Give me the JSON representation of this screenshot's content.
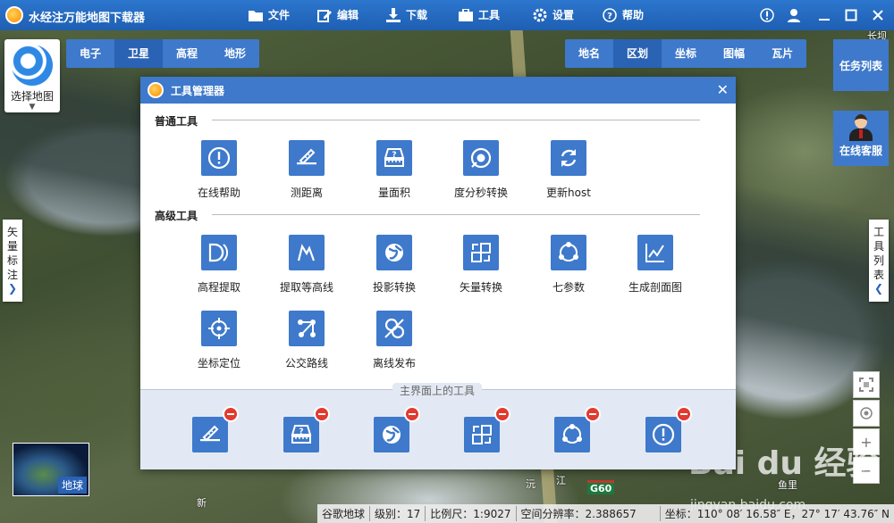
{
  "app": {
    "title": "水经注万能地图下载器"
  },
  "menu": [
    {
      "label": "文件",
      "icon": "folder-icon"
    },
    {
      "label": "编辑",
      "icon": "edit-icon"
    },
    {
      "label": "下载",
      "icon": "download-icon"
    },
    {
      "label": "工具",
      "icon": "toolbox-icon"
    },
    {
      "label": "设置",
      "icon": "gear-icon"
    },
    {
      "label": "帮助",
      "icon": "help-icon"
    }
  ],
  "window_controls": [
    "info-icon",
    "user-icon",
    "minimize-icon",
    "maximize-icon",
    "close-icon"
  ],
  "map_type_tabs": [
    {
      "label": "电子",
      "active": false
    },
    {
      "label": "卫星",
      "active": true
    },
    {
      "label": "高程",
      "active": false
    },
    {
      "label": "地形",
      "active": false
    }
  ],
  "region_tabs": [
    {
      "label": "地名",
      "active": false
    },
    {
      "label": "区划",
      "active": true
    },
    {
      "label": "坐标",
      "active": false
    },
    {
      "label": "图幅",
      "active": false
    },
    {
      "label": "瓦片",
      "active": false
    }
  ],
  "select_map": {
    "label": "选择地图"
  },
  "task_list": {
    "label": "任务列表"
  },
  "online_service": {
    "label": "在线客服"
  },
  "left_side_tab": {
    "label": "矢量标注",
    "chars": [
      "矢",
      "量",
      "标",
      "注"
    ]
  },
  "right_side_tab": {
    "label": "工具列表",
    "chars": [
      "工",
      "具",
      "列",
      "表"
    ]
  },
  "earth_mini": {
    "label": "地球"
  },
  "tool_manager": {
    "title": "工具管理器",
    "sections": {
      "common": {
        "title": "普通工具",
        "tools": [
          {
            "label": "在线帮助",
            "icon": "help-circle-icon"
          },
          {
            "label": "测距离",
            "icon": "ruler-icon"
          },
          {
            "label": "量面积",
            "icon": "area-measure-icon"
          },
          {
            "label": "度分秒转换",
            "icon": "dms-convert-icon"
          },
          {
            "label": "更新host",
            "icon": "refresh-icon"
          }
        ]
      },
      "advanced": {
        "title": "高级工具",
        "tools": [
          {
            "label": "高程提取",
            "icon": "elevation-icon"
          },
          {
            "label": "提取等高线",
            "icon": "contour-icon"
          },
          {
            "label": "投影转换",
            "icon": "globe-projection-icon"
          },
          {
            "label": "矢量转换",
            "icon": "vector-convert-icon"
          },
          {
            "label": "七参数",
            "icon": "seven-params-icon"
          },
          {
            "label": "生成剖面图",
            "icon": "profile-chart-icon"
          },
          {
            "label": "坐标定位",
            "icon": "crosshair-icon"
          },
          {
            "label": "公交路线",
            "icon": "bus-route-icon"
          },
          {
            "label": "离线发布",
            "icon": "offline-publish-icon"
          }
        ]
      }
    },
    "favorites": {
      "title": "主界面上的工具",
      "items": [
        "ruler-icon",
        "area-measure-icon",
        "globe-projection-icon",
        "vector-convert-icon",
        "seven-params-icon",
        "help-circle-icon"
      ]
    }
  },
  "status_bar": {
    "source": "谷歌地球",
    "level": "级别：17",
    "scale": "比例尺：1:9027",
    "resolution": "空间分辨率：2.388657",
    "coords": "坐标：110° 08′ 16.58″ E，27° 17′ 43.76″ N"
  },
  "map_labels": {
    "highway": "G60",
    "river_1": "沅",
    "river_2": "江",
    "town": "鱼里",
    "new": "新",
    "top_right": "长坝"
  },
  "watermark": {
    "brand": "Bai du 经验",
    "url": "jingyan.baidu.com"
  }
}
